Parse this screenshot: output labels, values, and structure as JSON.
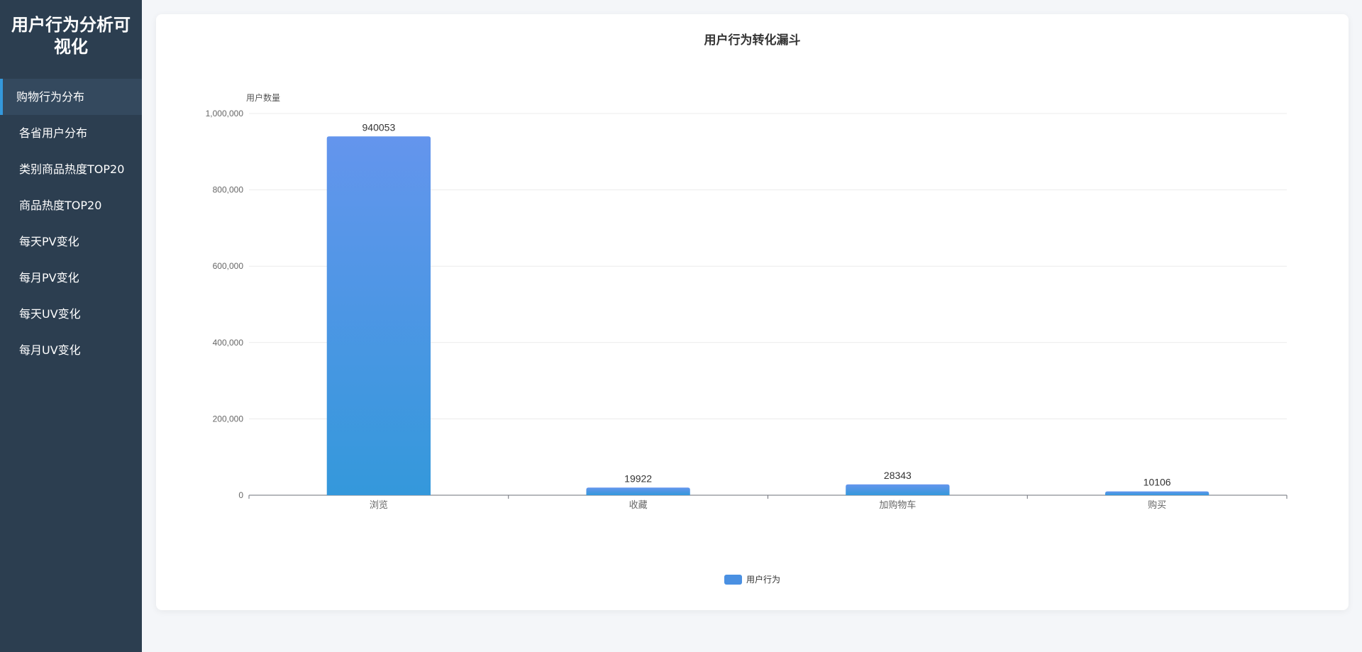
{
  "sidebar": {
    "title": "用户行为分析可视化",
    "items": [
      {
        "label": "购物行为分布",
        "active": true
      },
      {
        "label": "各省用户分布",
        "active": false
      },
      {
        "label": "类别商品热度TOP20",
        "active": false
      },
      {
        "label": "商品热度TOP20",
        "active": false
      },
      {
        "label": "每天PV变化",
        "active": false
      },
      {
        "label": "每月PV变化",
        "active": false
      },
      {
        "label": "每天UV变化",
        "active": false
      },
      {
        "label": "每月UV变化",
        "active": false
      }
    ]
  },
  "colors": {
    "sidebar_bg": "#2c3e50",
    "sidebar_active_bg": "#34495e",
    "accent": "#3498db",
    "bar_top": "#6495ed",
    "bar_bottom": "#3498db"
  },
  "chart_data": {
    "type": "bar",
    "title": "用户行为转化漏斗",
    "ylabel": "用户数量",
    "xlabel": "",
    "categories": [
      "浏览",
      "收藏",
      "加购物车",
      "购买"
    ],
    "series": [
      {
        "name": "用户行为",
        "values": [
          940053,
          19922,
          28343,
          10106
        ]
      }
    ],
    "ylim": [
      0,
      1000000
    ],
    "yticks": [
      0,
      200000,
      400000,
      600000,
      800000,
      1000000
    ],
    "ytick_labels": [
      "0",
      "200,000",
      "400,000",
      "600,000",
      "800,000",
      "1,000,000"
    ],
    "data_labels": [
      "940053",
      "19922",
      "28343",
      "10106"
    ],
    "grid": true,
    "legend": "bottom-center"
  }
}
